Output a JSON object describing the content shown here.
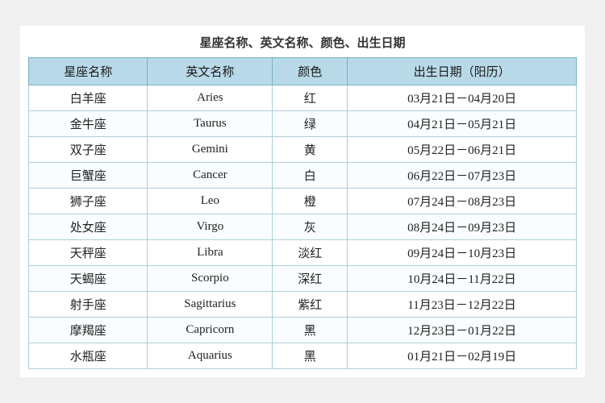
{
  "title": "星座名称、英文名称、颜色、出生日期",
  "table": {
    "headers": [
      "星座名称",
      "英文名称",
      "颜色",
      "出生日期（阳历）"
    ],
    "rows": [
      [
        "白羊座",
        "Aries",
        "红",
        "03月21日－04月20日"
      ],
      [
        "金牛座",
        "Taurus",
        "绿",
        "04月21日－05月21日"
      ],
      [
        "双子座",
        "Gemini",
        "黄",
        "05月22日－06月21日"
      ],
      [
        "巨蟹座",
        "Cancer",
        "白",
        "06月22日－07月23日"
      ],
      [
        "狮子座",
        "Leo",
        "橙",
        "07月24日－08月23日"
      ],
      [
        "处女座",
        "Virgo",
        "灰",
        "08月24日－09月23日"
      ],
      [
        "天秤座",
        "Libra",
        "淡红",
        "09月24日－10月23日"
      ],
      [
        "天蝎座",
        "Scorpio",
        "深红",
        "10月24日－11月22日"
      ],
      [
        "射手座",
        "Sagittarius",
        "紫红",
        "11月23日－12月22日"
      ],
      [
        "摩羯座",
        "Capricorn",
        "黑",
        "12月23日－01月22日"
      ],
      [
        "水瓶座",
        "Aquarius",
        "黑",
        "01月21日－02月19日"
      ]
    ]
  }
}
